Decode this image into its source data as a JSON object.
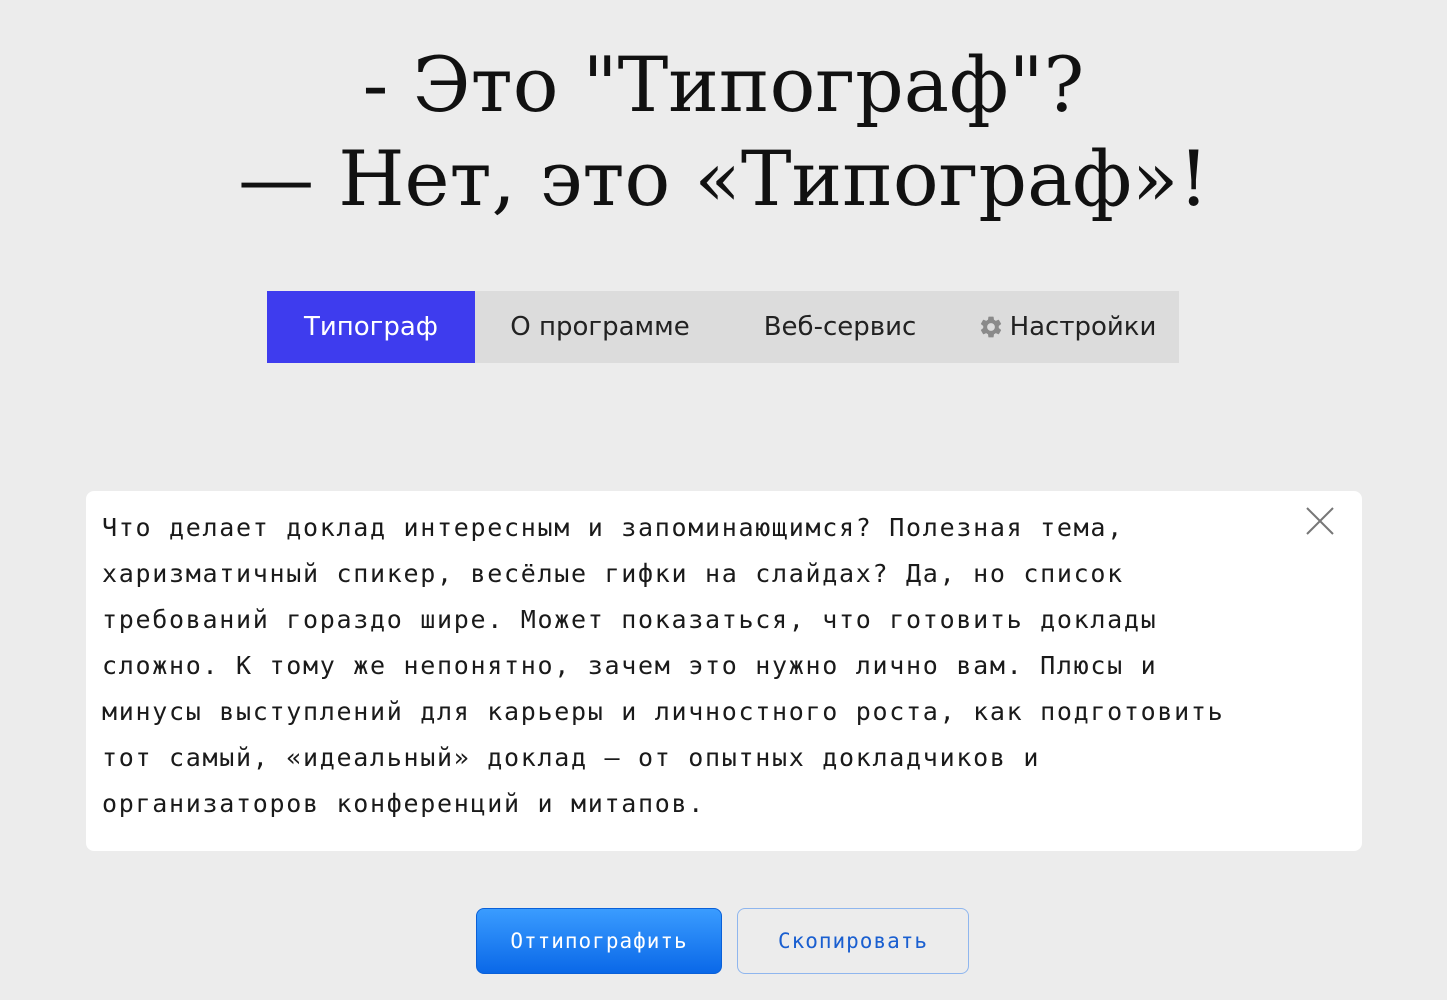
{
  "heading": {
    "line1": "- Это \"Типограф\"?",
    "line2": "— Нет, это «Типограф»!"
  },
  "tabs": [
    {
      "label": "Типограф",
      "active": true
    },
    {
      "label": "О программе",
      "active": false
    },
    {
      "label": "Веб-сервис",
      "active": false
    },
    {
      "label": "Настройки",
      "active": false,
      "icon": "gear-icon"
    }
  ],
  "editor": {
    "text": "Что делает доклад интересным и запоминающимся? Полезная тема, харизматичный спикер, весёлые гифки на слайдах? Да, но список требований гораздо шире. Может показаться, что готовить доклады сложно. К тому же непонятно, зачем это нужно лично вам. Плюсы и минусы выступлений для карьеры и личностного роста, как подготовить тот самый, «идеальный» доклад — от опытных докладчиков и организаторов конференций и митапов.",
    "clear_icon": "close-icon"
  },
  "buttons": {
    "typograph": "Оттипографить",
    "copy": "Скопировать"
  },
  "colors": {
    "background": "#ececec",
    "active_tab": "#3e3cee",
    "primary_button": "#1a7ff5",
    "secondary_text": "#1a5fd0"
  }
}
